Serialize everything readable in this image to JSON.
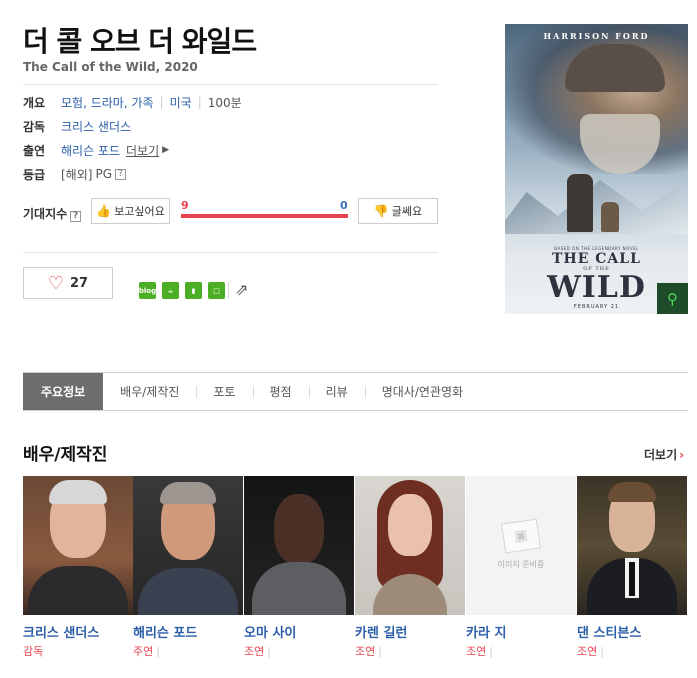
{
  "movie": {
    "title_ko": "더 콜 오브 더 와일드",
    "title_en": "The Call of the Wild, 2020"
  },
  "info": {
    "overview_label": "개요",
    "genres": "모험, 드라마, 가족",
    "country": "미국",
    "runtime": "100분",
    "director_label": "감독",
    "director": "크리스 샌더스",
    "cast_label": "출연",
    "lead_actor": "해리슨 포드",
    "cast_more": "더보기",
    "rating_label": "등급",
    "rating_region": "[해외]",
    "rating": "PG",
    "help_mark": "?"
  },
  "expectation": {
    "label": "기대지수",
    "want_label": "보고싶어요",
    "dont_label": "글쎄요",
    "want_count": "9",
    "dont_count": "0"
  },
  "like": {
    "count": "27"
  },
  "share": {
    "blog_label": "blog"
  },
  "poster": {
    "actor_name": "HARRISON FORD",
    "tagline": "BASED ON THE LEGENDARY NOVEL",
    "title_line1": "THE CALL",
    "title_line2": "OF THE",
    "title_line3": "WILD",
    "release": "FEBRUARY 21"
  },
  "tabs": [
    {
      "label": "주요정보"
    },
    {
      "label": "배우/제작진"
    },
    {
      "label": "포토"
    },
    {
      "label": "평점"
    },
    {
      "label": "리뷰"
    },
    {
      "label": "명대사/연관영화"
    }
  ],
  "cast_section": {
    "title": "배우/제작진",
    "more": "더보기",
    "no_image_text": "이미지 준비중",
    "people": [
      {
        "name": "크리스 샌더스",
        "role": "감독"
      },
      {
        "name": "해리슨 포드",
        "role": "주연"
      },
      {
        "name": "오마 사이",
        "role": "조연"
      },
      {
        "name": "카렌 길런",
        "role": "조연"
      },
      {
        "name": "카라 지",
        "role": "조연"
      },
      {
        "name": "댄 스티븐스",
        "role": "조연"
      }
    ]
  }
}
